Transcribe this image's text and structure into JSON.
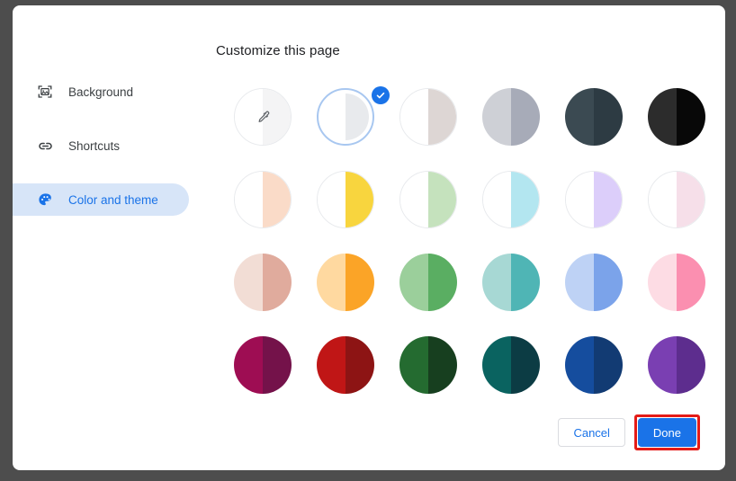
{
  "dialog": {
    "title": "Customize this page"
  },
  "sidebar": {
    "items": [
      {
        "label": "Background",
        "icon": "image-icon",
        "selected": false
      },
      {
        "label": "Shortcuts",
        "icon": "link-icon",
        "selected": false
      },
      {
        "label": "Color and theme",
        "icon": "palette-icon",
        "selected": true
      }
    ]
  },
  "footer": {
    "cancel_label": "Cancel",
    "done_label": "Done",
    "done_highlight_color": "#e41b17",
    "accent_color": "#1a73e8"
  },
  "colors": {
    "selected_index": 1,
    "swatches": [
      {
        "name": "custom-color-picker",
        "left": "#ffffff",
        "right": "#f4f4f5",
        "outlined": true,
        "icon": "eyedropper-icon"
      },
      {
        "name": "default-grey",
        "left": "#ffffff",
        "right": "#e8eaed",
        "outlined": false,
        "icon": ""
      },
      {
        "name": "warm-grey",
        "left": "#ffffff",
        "right": "#ddd6d4",
        "outlined": true,
        "icon": ""
      },
      {
        "name": "cool-grey",
        "left": "#ced0d6",
        "right": "#a7abb8",
        "outlined": false,
        "icon": ""
      },
      {
        "name": "slate-dark",
        "left": "#3b4a52",
        "right": "#2d3b43",
        "outlined": false,
        "icon": ""
      },
      {
        "name": "near-black",
        "left": "#2c2c2c",
        "right": "#080808",
        "outlined": false,
        "icon": ""
      },
      {
        "name": "pale-peach",
        "left": "#ffffff",
        "right": "#fadbc8",
        "outlined": true,
        "icon": ""
      },
      {
        "name": "pale-yellow",
        "left": "#ffffff",
        "right": "#f8d53e",
        "outlined": true,
        "icon": ""
      },
      {
        "name": "pale-green",
        "left": "#ffffff",
        "right": "#c5e2bd",
        "outlined": true,
        "icon": ""
      },
      {
        "name": "pale-cyan",
        "left": "#ffffff",
        "right": "#b3e6f0",
        "outlined": true,
        "icon": ""
      },
      {
        "name": "pale-purple",
        "left": "#ffffff",
        "right": "#dccefa",
        "outlined": true,
        "icon": ""
      },
      {
        "name": "pale-pink",
        "left": "#ffffff",
        "right": "#f6dfe9",
        "outlined": true,
        "icon": ""
      },
      {
        "name": "rose",
        "left": "#f2ddd5",
        "right": "#e0ab9d",
        "outlined": false,
        "icon": ""
      },
      {
        "name": "orange",
        "left": "#ffd9a0",
        "right": "#fba427",
        "outlined": false,
        "icon": ""
      },
      {
        "name": "green",
        "left": "#9bcf9b",
        "right": "#5aae62",
        "outlined": false,
        "icon": ""
      },
      {
        "name": "teal",
        "left": "#a7d8d4",
        "right": "#4fb5b5",
        "outlined": false,
        "icon": ""
      },
      {
        "name": "periwinkle",
        "left": "#bed2f5",
        "right": "#7ba3ea",
        "outlined": false,
        "icon": ""
      },
      {
        "name": "pink",
        "left": "#fddce4",
        "right": "#fb8fb0",
        "outlined": false,
        "icon": ""
      },
      {
        "name": "deep-magenta",
        "left": "#9e0d53",
        "right": "#74124a",
        "outlined": false,
        "icon": ""
      },
      {
        "name": "deep-red",
        "left": "#c01616",
        "right": "#8d1414",
        "outlined": false,
        "icon": ""
      },
      {
        "name": "deep-green",
        "left": "#246b30",
        "right": "#173f1f",
        "outlined": false,
        "icon": ""
      },
      {
        "name": "deep-teal",
        "left": "#0a6360",
        "right": "#0c3c44",
        "outlined": false,
        "icon": ""
      },
      {
        "name": "deep-blue",
        "left": "#154d9e",
        "right": "#123b73",
        "outlined": false,
        "icon": ""
      },
      {
        "name": "deep-purple",
        "left": "#7a3fb2",
        "right": "#5d2d8e",
        "outlined": false,
        "icon": ""
      }
    ]
  }
}
